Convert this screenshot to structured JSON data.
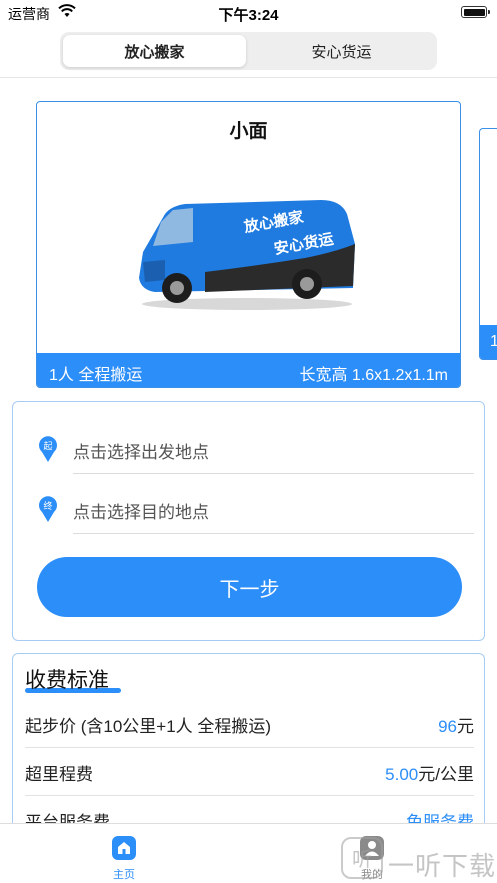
{
  "status_bar": {
    "carrier": "运营商",
    "time": "下午3:24"
  },
  "segments": {
    "active": "放心搬家",
    "inactive": "安心货运"
  },
  "vehicle": {
    "name": "小面",
    "van_text_line1": "放心搬家",
    "van_text_line2": "安心货运",
    "service": "1人 全程搬运",
    "dimensions": "长宽高 1.6x1.2x1.1m",
    "next_card_peek": "1"
  },
  "address": {
    "start_placeholder": "点击选择出发地点",
    "start_badge": "起",
    "end_placeholder": "点击选择目的地点",
    "end_badge": "终",
    "next_button": "下一步"
  },
  "fees": {
    "title": "收费标准",
    "rows": [
      {
        "label": "起步价 (含10公里+1人 全程搬运)",
        "value": "96",
        "unit": "元"
      },
      {
        "label": "超里程费",
        "value": "5.00",
        "unit": "元/公里"
      },
      {
        "label": "平台服务费",
        "value": "免服务费",
        "unit": ""
      }
    ]
  },
  "tabs": [
    {
      "label": "主页",
      "icon": "home-icon"
    },
    {
      "label": "我的",
      "icon": "profile-icon"
    }
  ],
  "watermark": {
    "text": "一听下载",
    "logo_glyph": "听"
  },
  "colors": {
    "accent": "#2c8ef8",
    "card_border": "#a7ccf3"
  }
}
